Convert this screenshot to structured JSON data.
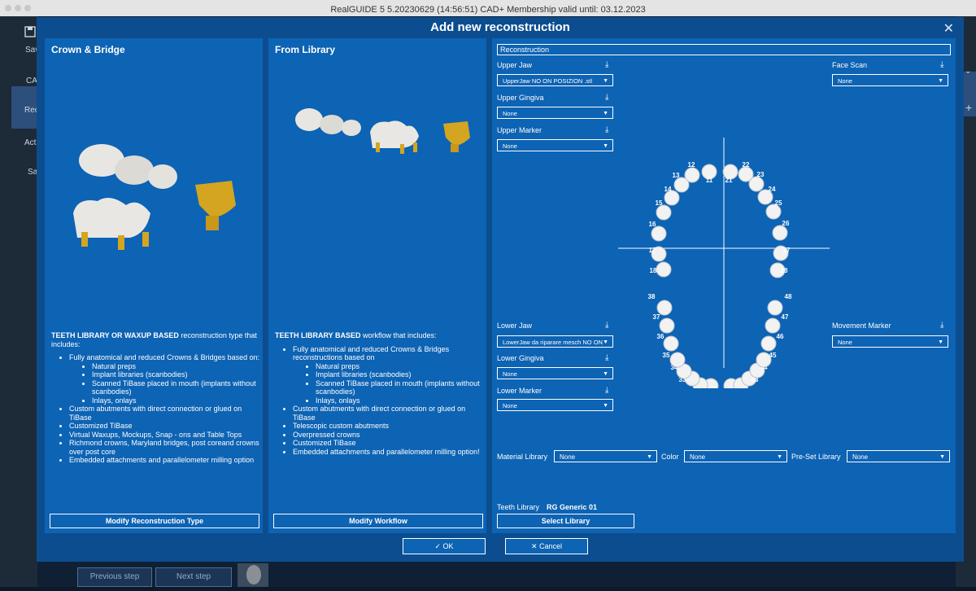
{
  "window_title": "RealGUIDE 5  5.20230629 (14:56:51)  CAD+ Membership valid until: 03.12.2023",
  "dialog_title": "Add new reconstruction",
  "sidebar_items": [
    "Sav",
    "CAD",
    "Reco",
    "Actio",
    "Sa"
  ],
  "bottom_buttons": {
    "previous": "Previous step",
    "next": "Next step"
  },
  "crown_bridge": {
    "title": "Crown & Bridge",
    "desc_bold": "TEETH LIBRARY OR WAXUP BASED",
    "desc_rest": " reconstruction type that includes:",
    "bullets": [
      "Fully anatomical and reduced Crowns & Bridges based on:",
      "Custom abutments with direct connection or glued on TiBase",
      "Customized TiBase",
      "Virtual Waxups, Mockups, Snap - ons and Table Tops",
      "Richmond crowns, Maryland bridges, post coreand crowns over post core",
      "Embedded attachments and parallelometer milling option"
    ],
    "sub_bullets": [
      "Natural preps",
      "Implant libraries (scanbodies)",
      "Scanned TiBase placed in mouth (implants without scanbodies)",
      "Inlays, onlays"
    ],
    "button": "Modify Reconstruction Type"
  },
  "from_library": {
    "title": "From Library",
    "desc_bold": "TEETH LIBRARY BASED",
    "desc_rest": " workflow that includes:",
    "bullets": [
      "Fully anatomical and reduced Crowns & Bridges reconstructions based on",
      "Custom abutments with direct connection or glued on TiBase",
      "Telescopic custom abutments",
      "Overpressed crowns",
      "Customized TiBase",
      "Embedded attachments and parallelometer milling option!"
    ],
    "sub_bullets": [
      "Natural preps",
      "Implant libraries (scanbodies)",
      "Scanned TiBase placed in mouth (implants without scanbodies)",
      "Inlays, onlays"
    ],
    "button": "Modify Workflow"
  },
  "reconstruction": {
    "header": "Reconstruction",
    "upper_jaw": {
      "label": "Upper Jaw",
      "value": "UpperJaw NO ON POSIZION .stl"
    },
    "upper_gingiva": {
      "label": "Upper Gingiva",
      "value": "None"
    },
    "upper_marker": {
      "label": "Upper Marker",
      "value": "None"
    },
    "face_scan": {
      "label": "Face Scan",
      "value": "None"
    },
    "lower_jaw": {
      "label": "Lower Jaw",
      "value": "LowerJaw da riparare mesch NO ON"
    },
    "lower_gingiva": {
      "label": "Lower Gingiva",
      "value": "None"
    },
    "lower_marker": {
      "label": "Lower Marker",
      "value": "None"
    },
    "movement_marker": {
      "label": "Movement Marker",
      "value": "None"
    },
    "download_icon": "download-icon",
    "upper_teeth": [
      "11",
      "12",
      "13",
      "14",
      "15",
      "16",
      "17",
      "18",
      "21",
      "22",
      "23",
      "24",
      "25",
      "26",
      "27",
      "28"
    ],
    "lower_teeth": [
      "31",
      "32",
      "33",
      "34",
      "35",
      "36",
      "37",
      "38",
      "41",
      "42",
      "43",
      "44",
      "45",
      "46",
      "47",
      "48"
    ]
  },
  "libraries": {
    "material_label": "Material Library",
    "material_value": "None",
    "color_label": "Color",
    "color_value": "None",
    "preset_label": "Pre-Set Library",
    "preset_value": "None",
    "teeth_label": "Teeth Library",
    "teeth_value": "RG Generic 01",
    "select_button": "Select Library"
  },
  "actions": {
    "ok": "OK",
    "cancel": "Cancel"
  },
  "colors": {
    "dialog_bg": "#0c4d8f",
    "panel_bg": "#0d63b4",
    "accent_gold": "#d4a520"
  }
}
